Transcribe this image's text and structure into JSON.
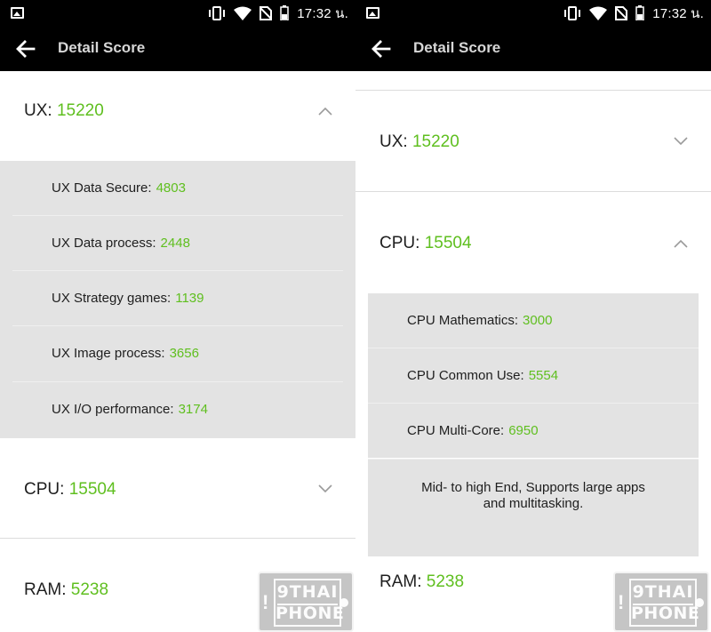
{
  "status_bar": {
    "time": "17:32 น."
  },
  "app_bar": {
    "title": "Detail Score"
  },
  "colors": {
    "accent": "#5fbf1f",
    "bar_bg": "#000000",
    "sub_bg": "#e3e3e3"
  },
  "left": {
    "ux": {
      "label": "UX:",
      "value": "15220",
      "expanded": true
    },
    "ux_items": [
      {
        "label": "UX Data Secure:",
        "value": "4803"
      },
      {
        "label": "UX Data process:",
        "value": "2448"
      },
      {
        "label": "UX Strategy games:",
        "value": "1139"
      },
      {
        "label": "UX Image process:",
        "value": "3656"
      },
      {
        "label": "UX I/O performance:",
        "value": "3174"
      }
    ],
    "cpu": {
      "label": "CPU:",
      "value": "15504",
      "expanded": false
    },
    "ram": {
      "label": "RAM:",
      "value": "5238"
    }
  },
  "right": {
    "ux": {
      "label": "UX:",
      "value": "15220",
      "expanded": false
    },
    "cpu": {
      "label": "CPU:",
      "value": "15504",
      "expanded": true
    },
    "cpu_items": [
      {
        "label": "CPU Mathematics:",
        "value": "3000"
      },
      {
        "label": "CPU Common Use:",
        "value": "5554"
      },
      {
        "label": "CPU Multi-Core:",
        "value": "6950"
      }
    ],
    "cpu_note_line1": "Mid- to high End, Supports large apps",
    "cpu_note_line2": "and multitasking.",
    "ram": {
      "label": "RAM:",
      "value": "5238"
    }
  },
  "watermark": {
    "line1": "9THAI",
    "line2": "PHONE"
  }
}
